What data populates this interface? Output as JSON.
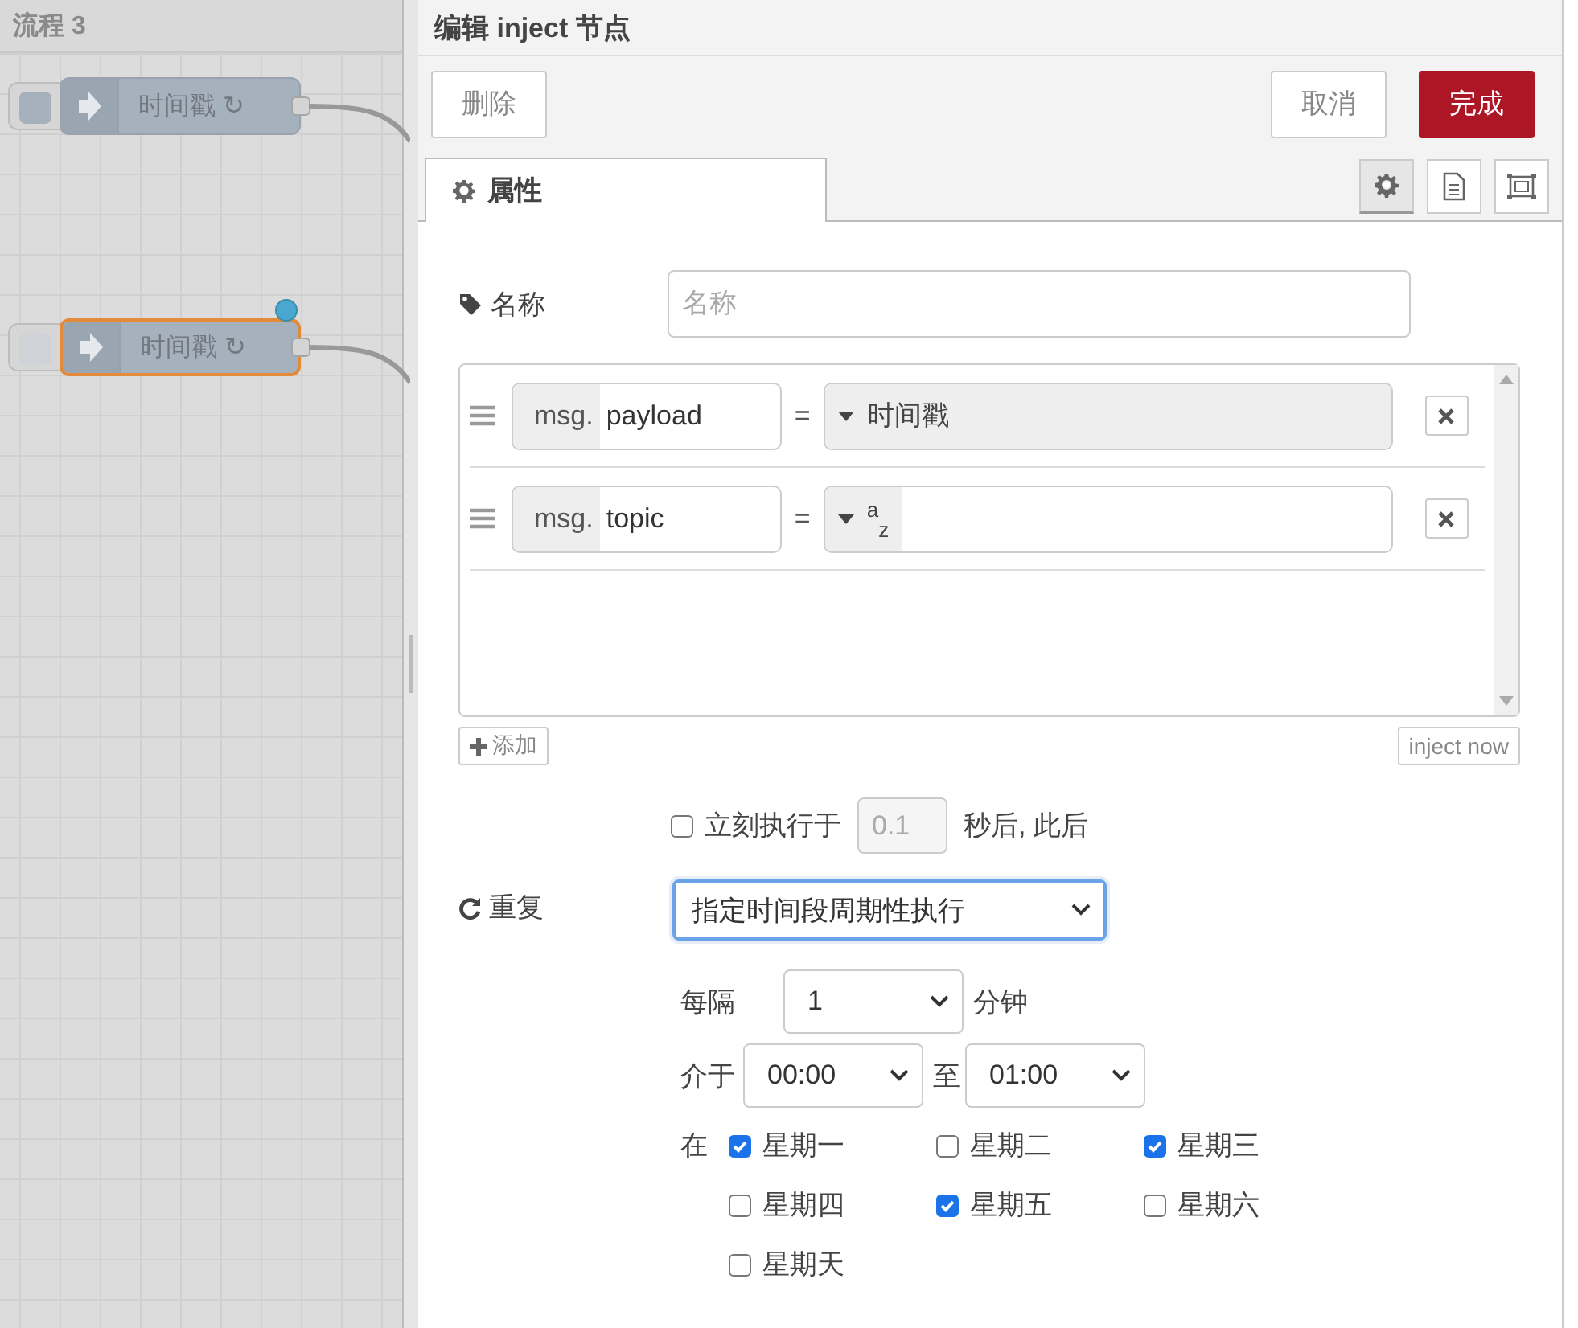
{
  "workspace": {
    "tab_title": "流程 3",
    "nodes": [
      {
        "label": "时间戳 ↻",
        "selected": false,
        "changed": false
      },
      {
        "label": "时间戳 ↻",
        "selected": true,
        "changed": true
      }
    ]
  },
  "editor": {
    "title": "编辑 inject 节点",
    "delete_button": "删除",
    "cancel_button": "取消",
    "done_button": "完成",
    "tabs": [
      {
        "label": "属性",
        "selected": true
      }
    ],
    "side_tabs": [
      {
        "kind": "settings",
        "selected": true
      },
      {
        "kind": "description",
        "selected": false
      },
      {
        "kind": "appearance",
        "selected": false
      }
    ],
    "name": {
      "label": "名称",
      "placeholder": "名称"
    },
    "properties": [
      {
        "prefix": "msg.",
        "key": "payload",
        "operator": "=",
        "kind": "timestamp",
        "type_label": "时间戳"
      },
      {
        "prefix": "msg.",
        "key": "topic",
        "operator": "=",
        "kind": "string",
        "type_label": "$^{a}$$_{z}$"
      }
    ],
    "add_button": "添加",
    "inject_button": "inject now",
    "once": {
      "checked": false,
      "label": "立刻执行于",
      "delay": "0.1",
      "suffix": "秒后, 此后"
    },
    "repeat": {
      "label": "重复",
      "value": "指定时间段周期性执行"
    },
    "interval": {
      "label": "每隔",
      "value": "1",
      "unit": "分钟"
    },
    "between": {
      "label": "介于",
      "from": "00:00",
      "to_label": "至",
      "to": "01:00"
    },
    "days": {
      "label": "在",
      "items": [
        {
          "label": "星期一",
          "checked": true
        },
        {
          "label": "星期二",
          "checked": false
        },
        {
          "label": "星期三",
          "checked": true
        },
        {
          "label": "星期四",
          "checked": false
        },
        {
          "label": "星期五",
          "checked": true
        },
        {
          "label": "星期六",
          "checked": false
        },
        {
          "label": "星期天",
          "checked": false
        }
      ]
    }
  }
}
